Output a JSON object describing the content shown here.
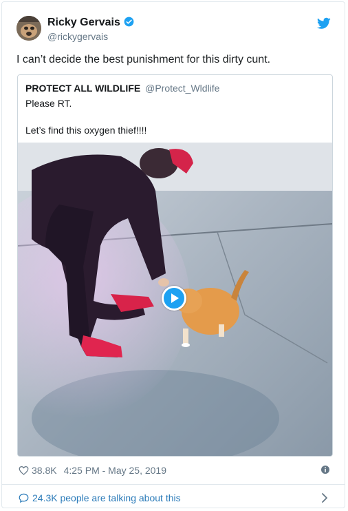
{
  "tweet": {
    "author_name": "Ricky Gervais",
    "author_handle": "@rickygervais",
    "text": "I can’t decide the best punishment for this dirty cunt.",
    "likes": "38.8K",
    "timestamp": "4:25 PM - May 25, 2019",
    "talking": "24.3K people are talking about this"
  },
  "quoted": {
    "author_name": "PROTECT ALL WILDLIFE",
    "author_handle": "@Protect_Wldlife",
    "line1": "Please RT.",
    "line2": "Let’s find this oxygen thief!!!!"
  },
  "icons": {
    "verified": "verified-badge-icon",
    "twitter": "twitter-bird-icon",
    "like": "heart-icon",
    "info": "info-icon",
    "reply": "speech-bubble-icon",
    "chevron": "chevron-right-icon",
    "play": "play-icon"
  },
  "colors": {
    "twitter_blue": "#1da1f2",
    "link_blue": "#2b7bb9",
    "muted_text": "#657786",
    "border": "#e1e8ed"
  }
}
